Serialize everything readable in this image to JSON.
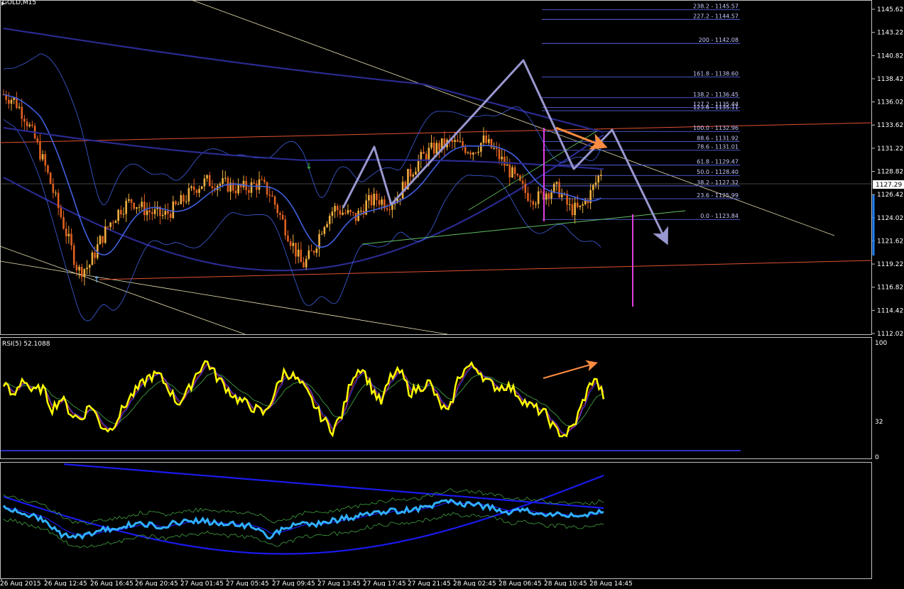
{
  "window": {
    "title": "GOLD,M15"
  },
  "colors": {
    "background": "#000000",
    "frame": "#c0c0c0",
    "bull_candle": "#f0b040",
    "bear_candle": "#e06020",
    "bollinger": "#4060e0",
    "ma_slow": "#2a2a90",
    "fib": "#6070ff",
    "trend_red": "#e05030",
    "trend_white": "#e8e0b0",
    "trend_green": "#60c060",
    "arrow_lavender": "#9a98d0",
    "arrow_orange": "#ff8c40",
    "magenta": "#e040e0",
    "rsi_main": "#ffff00",
    "rsi_avg_blue": "#4040ff",
    "rsi_avg_red": "#e03050",
    "rsi_avg_green": "#40a040",
    "osc_main": "#30b0ff",
    "osc_band": "#1a1aee",
    "osc_env": "#40a040",
    "current_price_tag": "#ffffff"
  },
  "chart_data": [
    {
      "type": "candlestick",
      "name": "price",
      "symbol": "GOLD",
      "timeframe": "M15",
      "ylim": [
        1112.02,
        1146.8
      ],
      "y_ticks": [
        "1145.62",
        "1143.22",
        "1140.82",
        "1138.42",
        "1136.02",
        "1133.62",
        "1131.22",
        "1128.82",
        "1126.42",
        "1124.02",
        "1121.62",
        "1119.22",
        "1116.82",
        "1114.42",
        "1112.02"
      ],
      "current_price": "1127.29",
      "x_ticks": [
        "26 Aug 2015",
        "26 Aug 12:45",
        "26 Aug 16:45",
        "26 Aug 20:45",
        "27 Aug 01:45",
        "27 Aug 05:45",
        "27 Aug 09:45",
        "27 Aug 13:45",
        "27 Aug 17:45",
        "27 Aug 21:45",
        "28 Aug 02:45",
        "28 Aug 06:45",
        "28 Aug 10:45",
        "28 Aug 14:45"
      ],
      "close_path": [
        1136.8,
        1136.2,
        1134.5,
        1132.0,
        1129.0,
        1125.5,
        1122.0,
        1118.5,
        1119.0,
        1121.5,
        1123.5,
        1125.0,
        1125.8,
        1125.0,
        1124.5,
        1124.2,
        1125.0,
        1126.0,
        1127.2,
        1127.8,
        1127.6,
        1127.4,
        1127.0,
        1127.2,
        1127.6,
        1126.5,
        1124.0,
        1121.5,
        1119.0,
        1120.5,
        1123.5,
        1125.0,
        1124.5,
        1124.0,
        1125.5,
        1126.0,
        1125.5,
        1126.2,
        1128.5,
        1130.0,
        1131.0,
        1131.5,
        1131.8,
        1131.4,
        1131.0,
        1132.0,
        1131.0,
        1129.5,
        1128.0,
        1126.5,
        1126.0,
        1126.8,
        1127.0,
        1125.0,
        1124.8,
        1126.5,
        1128.8
      ],
      "fibonacci": [
        {
          "level": "238.2",
          "price": "1145.57"
        },
        {
          "level": "227.2",
          "price": "1144.57"
        },
        {
          "level": "200",
          "price": "1142.08"
        },
        {
          "level": "161.8",
          "price": "1138.60"
        },
        {
          "level": "138.2",
          "price": "1136.45"
        },
        {
          "level": "127.2",
          "price": "1135.44"
        },
        {
          "level": "123.6",
          "price": "1135.11"
        },
        {
          "level": "100.0",
          "price": "1132.96"
        },
        {
          "level": "88.6",
          "price": "1131.92"
        },
        {
          "level": "78.6",
          "price": "1131.01"
        },
        {
          "level": "61.8",
          "price": "1129.47"
        },
        {
          "level": "50.0",
          "price": "1128.40"
        },
        {
          "level": "38.2",
          "price": "1127.32"
        },
        {
          "level": "23.6",
          "price": "1125.99"
        },
        {
          "level": "0.0",
          "price": "1123.84"
        }
      ]
    },
    {
      "type": "line",
      "name": "RSI(5)",
      "label": "RSI(5) 52.1088",
      "ylim": [
        0,
        100
      ],
      "y_ticks": [
        "100",
        "32",
        "0"
      ],
      "values": [
        65,
        50,
        70,
        55,
        60,
        40,
        50,
        35,
        30,
        45,
        25,
        20,
        35,
        50,
        60,
        70,
        72,
        60,
        45,
        55,
        75,
        85,
        70,
        60,
        50,
        45,
        40,
        35,
        55,
        75,
        70,
        60,
        45,
        30,
        20,
        35,
        70,
        80,
        60,
        45,
        70,
        75,
        55,
        60,
        65,
        45,
        35,
        70,
        80,
        78,
        65,
        60,
        62,
        55,
        45,
        40,
        35,
        20,
        15,
        25,
        50,
        70,
        52
      ]
    },
    {
      "type": "line",
      "name": "oscillator",
      "ylim": [
        0,
        100
      ],
      "values": [
        60,
        58,
        55,
        50,
        45,
        35,
        30,
        32,
        35,
        38,
        40,
        42,
        44,
        43,
        42,
        44,
        46,
        48,
        47,
        45,
        44,
        43,
        42,
        40,
        30,
        38,
        42,
        45,
        44,
        46,
        48,
        50,
        52,
        55,
        55,
        57,
        58,
        58,
        62,
        64,
        66,
        65,
        64,
        62,
        60,
        55,
        56,
        58,
        55,
        52,
        55,
        53,
        50,
        54,
        58
      ]
    }
  ]
}
